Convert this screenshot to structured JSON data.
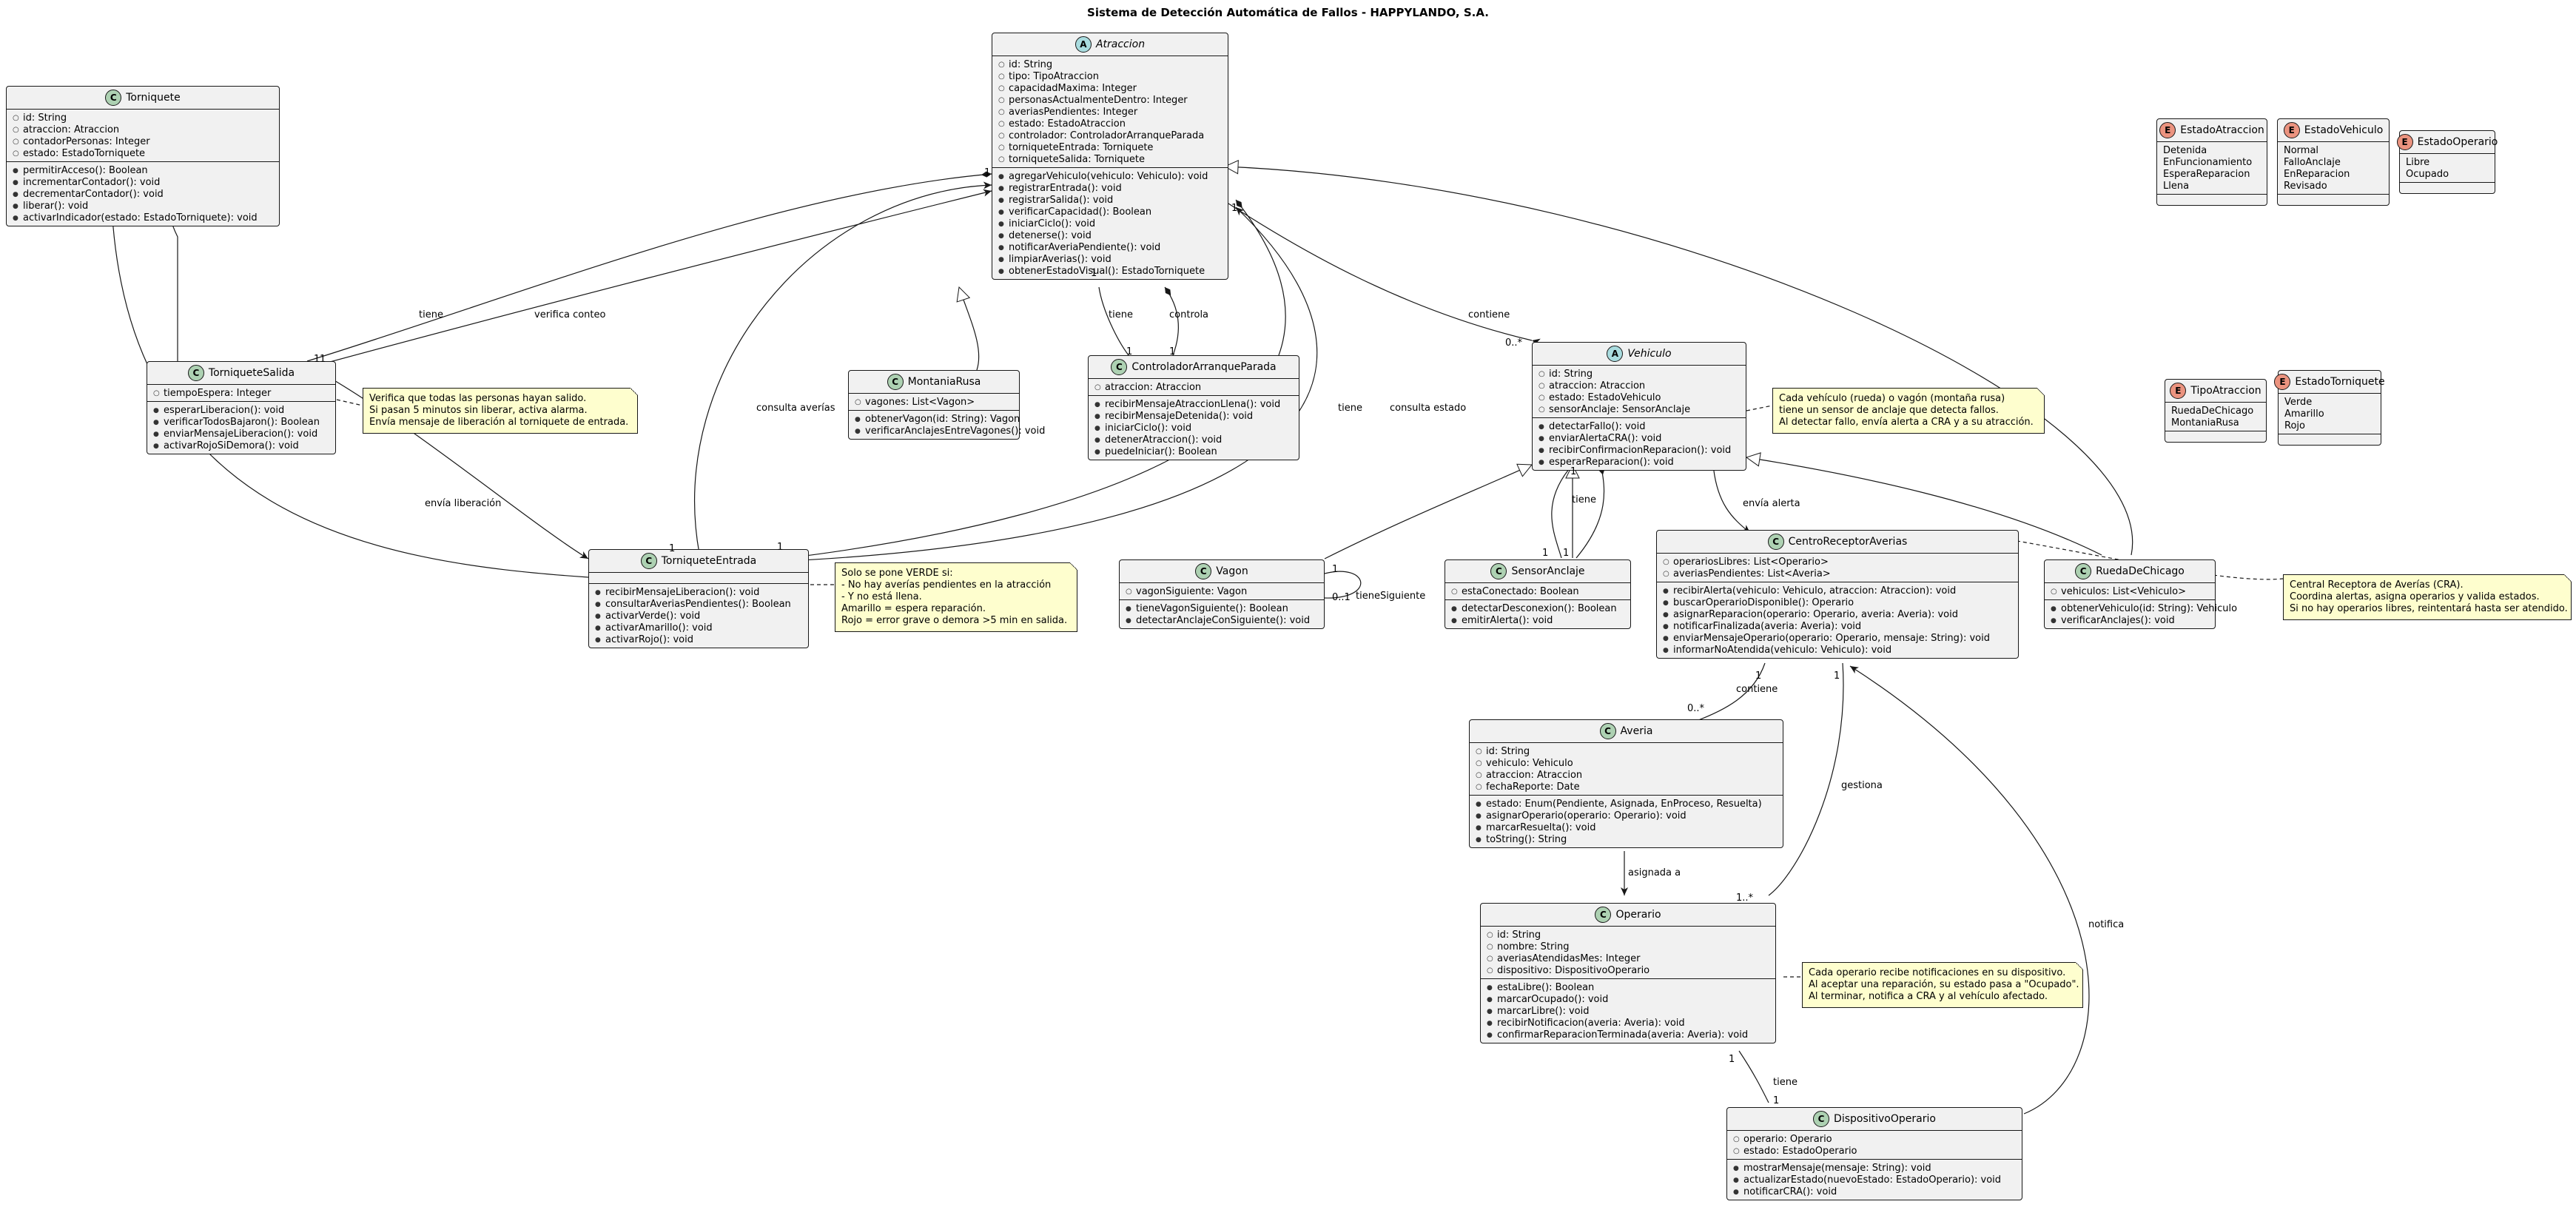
{
  "title": "Sistema de Detección Automática de Fallos - HAPPYLANDO, S.A.",
  "classes": {
    "torniquete": {
      "kind": "C",
      "name": "Torniquete",
      "fields": [
        "id: String",
        "atraccion: Atraccion",
        "contadorPersonas: Integer",
        "estado: EstadoTorniquete"
      ],
      "methods": [
        "permitirAcceso(): Boolean",
        "incrementarContador(): void",
        "decrementarContador(): void",
        "liberar(): void",
        "activarIndicador(estado: EstadoTorniquete): void"
      ]
    },
    "atraccion": {
      "kind": "A",
      "name": "Atraccion",
      "fields": [
        "id: String",
        "tipo: TipoAtraccion",
        "capacidadMaxima: Integer",
        "personasActualmenteDentro: Integer",
        "averiasPendientes: Integer",
        "estado: EstadoAtraccion",
        "controlador: ControladorArranqueParada",
        "torniqueteEntrada: Torniquete",
        "torniqueteSalida: Torniquete"
      ],
      "methods": [
        "agregarVehiculo(vehiculo: Vehiculo): void",
        "registrarEntrada(): void",
        "registrarSalida(): void",
        "verificarCapacidad(): Boolean",
        "iniciarCiclo(): void",
        "detenerse(): void",
        "notificarAveriaPendiente(): void",
        "limpiarAverias(): void",
        "obtenerEstadoVisual(): EstadoTorniquete"
      ]
    },
    "torniqueteSalida": {
      "kind": "C",
      "name": "TorniqueteSalida",
      "fields": [
        "tiempoEspera: Integer"
      ],
      "methods": [
        "esperarLiberacion(): void",
        "verificarTodosBajaron(): Boolean",
        "enviarMensajeLiberacion(): void",
        "activarRojoSiDemora(): void"
      ]
    },
    "montaniaRusa": {
      "kind": "C",
      "name": "MontaniaRusa",
      "fields": [
        "vagones: List<Vagon>"
      ],
      "methods": [
        "obtenerVagon(id: String): Vagon",
        "verificarAnclajesEntreVagones(): void"
      ]
    },
    "controlador": {
      "kind": "C",
      "name": "ControladorArranqueParada",
      "fields": [
        "atraccion: Atraccion"
      ],
      "methods": [
        "recibirMensajeAtraccionLlena(): void",
        "recibirMensajeDetenida(): void",
        "iniciarCiclo(): void",
        "detenerAtraccion(): void",
        "puedeIniciar(): Boolean"
      ]
    },
    "vehiculo": {
      "kind": "A",
      "name": "Vehiculo",
      "fields": [
        "id: String",
        "atraccion: Atraccion",
        "estado: EstadoVehiculo",
        "sensorAnclaje: SensorAnclaje"
      ],
      "methods": [
        "detectarFallo(): void",
        "enviarAlertaCRA(): void",
        "recibirConfirmacionReparacion(): void",
        "esperarReparacion(): void"
      ]
    },
    "torniqueteEntrada": {
      "kind": "C",
      "name": "TorniqueteEntrada",
      "fields": [],
      "methods": [
        "recibirMensajeLiberacion(): void",
        "consultarAveriasPendientes(): Boolean",
        "activarVerde(): void",
        "activarAmarillo(): void",
        "activarRojo(): void"
      ]
    },
    "vagon": {
      "kind": "C",
      "name": "Vagon",
      "fields": [
        "vagonSiguiente: Vagon"
      ],
      "methods": [
        "tieneVagonSiguiente(): Boolean",
        "detectarAnclajeConSiguiente(): void"
      ]
    },
    "sensorAnclaje": {
      "kind": "C",
      "name": "SensorAnclaje",
      "fields": [
        "estaConectado: Boolean"
      ],
      "methods": [
        "detectarDesconexion(): Boolean",
        "emitirAlerta(): void"
      ]
    },
    "centro": {
      "kind": "C",
      "name": "CentroReceptorAverias",
      "fields": [
        "operariosLibres: List<Operario>",
        "averiasPendientes: List<Averia>"
      ],
      "methods": [
        "recibirAlerta(vehiculo: Vehiculo, atraccion: Atraccion): void",
        "buscarOperarioDisponible(): Operario",
        "asignarReparacion(operario: Operario, averia: Averia): void",
        "notificarFinalizada(averia: Averia): void",
        "enviarMensajeOperario(operario: Operario, mensaje: String): void",
        "informarNoAtendida(vehiculo: Vehiculo): void"
      ]
    },
    "rueda": {
      "kind": "C",
      "name": "RuedaDeChicago",
      "fields": [
        "vehiculos: List<Vehiculo>"
      ],
      "methods": [
        "obtenerVehiculo(id: String): Vehiculo",
        "verificarAnclajes(): void"
      ]
    },
    "averia": {
      "kind": "C",
      "name": "Averia",
      "fields": [
        "id: String",
        "vehiculo: Vehiculo",
        "atraccion: Atraccion",
        "fechaReporte: Date"
      ],
      "methods": [
        "estado: Enum(Pendiente, Asignada, EnProceso, Resuelta)",
        "asignarOperario(operario: Operario): void",
        "marcarResuelta(): void",
        "toString(): String"
      ]
    },
    "operario": {
      "kind": "C",
      "name": "Operario",
      "fields": [
        "id: String",
        "nombre: String",
        "averiasAtendidasMes: Integer",
        "dispositivo: DispositivoOperario"
      ],
      "methods": [
        "estaLibre(): Boolean",
        "marcarOcupado(): void",
        "marcarLibre(): void",
        "recibirNotificacion(averia: Averia): void",
        "confirmarReparacionTerminada(averia: Averia): void"
      ]
    },
    "dispositivo": {
      "kind": "C",
      "name": "DispositivoOperario",
      "fields": [
        "operario: Operario",
        "estado: EstadoOperario"
      ],
      "methods": [
        "mostrarMensaje(mensaje: String): void",
        "actualizarEstado(nuevoEstado: EstadoOperario): void",
        "notificarCRA(): void"
      ]
    }
  },
  "enums": {
    "estadoAtraccion": {
      "kind": "E",
      "name": "EstadoAtraccion",
      "values": [
        "Detenida",
        "EnFuncionamiento",
        "EsperaReparacion",
        "Llena"
      ]
    },
    "estadoVehiculo": {
      "kind": "E",
      "name": "EstadoVehiculo",
      "values": [
        "Normal",
        "FalloAnclaje",
        "EnReparacion",
        "Revisado"
      ]
    },
    "estadoOperario": {
      "kind": "E",
      "name": "EstadoOperario",
      "values": [
        "Libre",
        "Ocupado"
      ]
    },
    "tipoAtraccion": {
      "kind": "E",
      "name": "TipoAtraccion",
      "values": [
        "RuedaDeChicago",
        "MontaniaRusa"
      ]
    },
    "estadoTorniquete": {
      "kind": "E",
      "name": "EstadoTorniquete",
      "values": [
        "Verde",
        "Amarillo",
        "Rojo"
      ]
    }
  },
  "notes": {
    "salida": [
      "Verifica que todas las personas hayan salido.",
      "Si pasan 5 minutos sin liberar, activa alarma.",
      "Envía mensaje de liberación al torniquete de entrada."
    ],
    "entrada": [
      "Solo se pone VERDE si:",
      "- No hay averías pendientes en la atracción",
      "- Y no está llena.",
      "Amarillo = espera reparación.",
      "Rojo = error grave o demora >5 min en salida."
    ],
    "vehiculo": [
      "Cada vehículo (rueda) o vagón (montaña rusa)",
      "tiene un sensor de anclaje que detecta fallos.",
      "Al detectar fallo, envía alerta a CRA y a su atracción."
    ],
    "operario": [
      "Cada operario recibe notificaciones en su dispositivo.",
      "Al aceptar una reparación, su estado pasa a \"Ocupado\".",
      "Al terminar, notifica a CRA y al vehículo afectado."
    ],
    "cra": [
      "Central Receptora de Averías (CRA).",
      "Coordina alertas, asigna operarios y valida estados.",
      "Si no hay operarios libres, reintentará hasta ser atendido."
    ]
  },
  "edge_labels": {
    "tiene": "tiene",
    "verifica_conteo": "verifica conteo",
    "envia_liberacion": "envía liberación",
    "consulta_averias": "consulta averías",
    "consulta_estado": "consulta estado",
    "controla": "controla",
    "contiene": "contiene",
    "envia_alerta": "envía alerta",
    "tiene_siguiente": "tieneSiguiente",
    "gestiona": "gestiona",
    "asignada_a": "asignada a",
    "notifica": "notifica"
  },
  "multiplicities": {
    "one": "1",
    "zero_many": "0..*",
    "one_many": "1..*",
    "zero_one": "0..1"
  }
}
